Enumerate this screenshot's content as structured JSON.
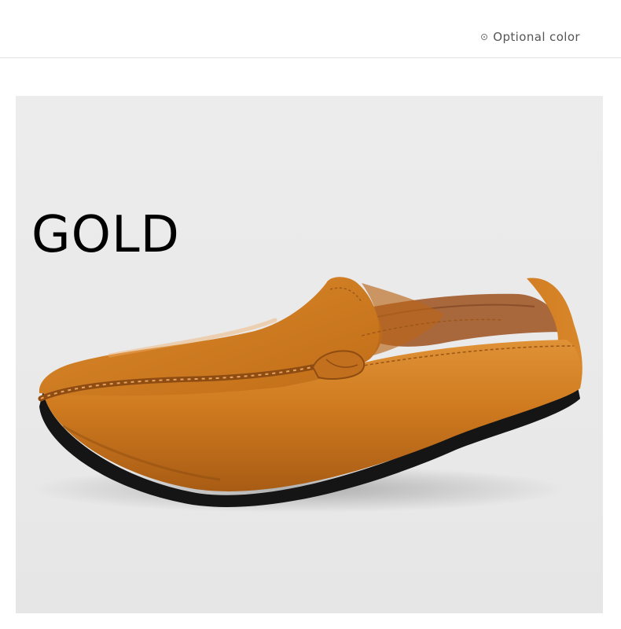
{
  "header": {
    "label": "Optional color"
  },
  "product": {
    "color_name": "GOLD",
    "image": "brown-leather-loafer",
    "colors": {
      "leather": "#c8711a",
      "leather_light": "#dc8a2c",
      "leather_dark": "#9a5512",
      "sole": "#151515",
      "lining": "#b06a3a"
    }
  }
}
